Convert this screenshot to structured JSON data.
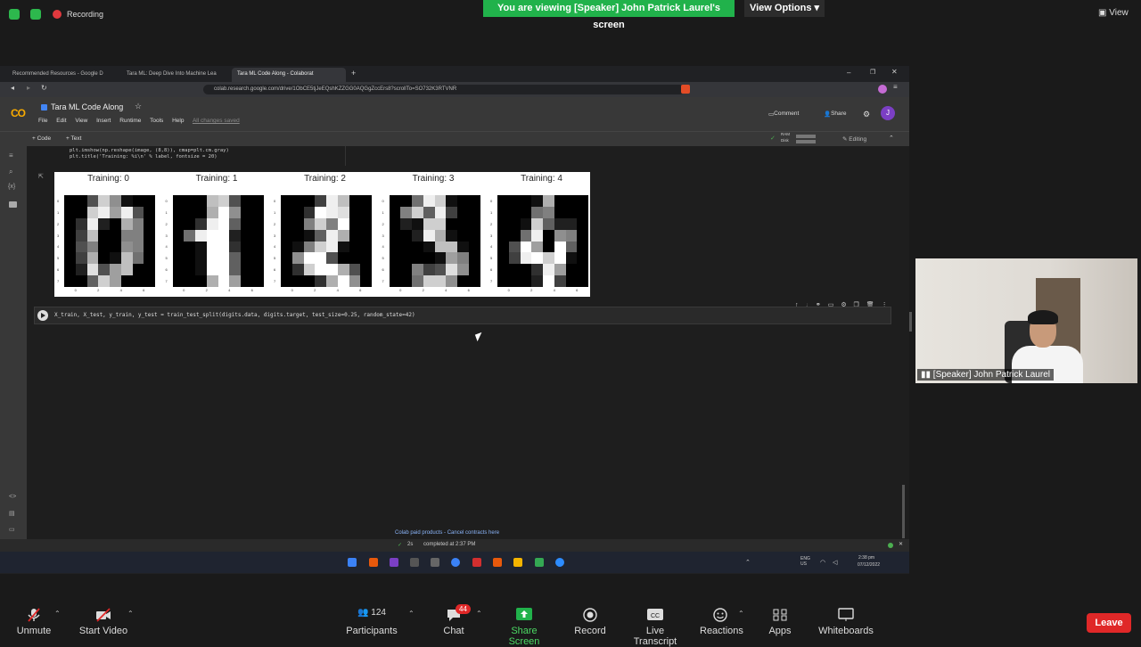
{
  "zoom_top": {
    "recording_label": "Recording",
    "banner": "You are viewing [Speaker] John Patrick Laurel's screen",
    "view_options": "View Options",
    "view": "View"
  },
  "browser": {
    "tabs": [
      "Recommended Resources - Google D",
      "Tara ML: Deep Dive Into Machine Lea",
      "Tara ML Code Along - Colaborat"
    ],
    "url": "colab.research.google.com/drive/1ObCE5tjJeEQshKZZGG0AQGgZccErs8?scrollTo=SO732K3RTVNR"
  },
  "colab": {
    "logo": "CO",
    "title": "Tara ML Code Along",
    "menu": [
      "File",
      "Edit",
      "View",
      "Insert",
      "Runtime",
      "Tools",
      "Help"
    ],
    "saved": "All changes saved",
    "comment": "Comment",
    "share": "Share",
    "avatar": "J",
    "add_code": "+ Code",
    "add_text": "+ Text",
    "ram": "RAM",
    "disk": "Disk",
    "editing": "Editing",
    "code_top_1": "plt.imshow(np.reshape(image, (8,8)), cmap=plt.cm.gray)",
    "code_top_2": "plt.title('Training: %i\\n' % label, fontsize = 20)",
    "code_cell": "X_train, X_test, y_train, y_test = train_test_split(digits.data, digits.target, test_size=0.25, random_state=42)",
    "footer_link": "Colab paid products - Cancel contracts here",
    "status_time": "2s",
    "status_text": "completed at 2:37 PM"
  },
  "digits": [
    {
      "title": "Training: 0",
      "pixels": [
        0,
        0,
        5,
        13,
        9,
        1,
        0,
        0,
        0,
        0,
        13,
        15,
        10,
        15,
        5,
        0,
        0,
        3,
        15,
        2,
        0,
        11,
        8,
        0,
        0,
        4,
        12,
        0,
        0,
        8,
        8,
        0,
        0,
        5,
        8,
        0,
        0,
        9,
        8,
        0,
        0,
        4,
        11,
        0,
        1,
        12,
        7,
        0,
        0,
        2,
        14,
        5,
        10,
        12,
        0,
        0,
        0,
        0,
        6,
        13,
        10,
        0,
        0,
        0
      ]
    },
    {
      "title": "Training: 1",
      "pixels": [
        0,
        0,
        0,
        12,
        13,
        5,
        0,
        0,
        0,
        0,
        0,
        11,
        16,
        9,
        0,
        0,
        0,
        0,
        3,
        15,
        16,
        6,
        0,
        0,
        0,
        7,
        15,
        16,
        16,
        2,
        0,
        0,
        0,
        0,
        1,
        16,
        16,
        3,
        0,
        0,
        0,
        0,
        1,
        16,
        16,
        6,
        0,
        0,
        0,
        0,
        1,
        16,
        16,
        6,
        0,
        0,
        0,
        0,
        0,
        11,
        16,
        10,
        0,
        0
      ]
    },
    {
      "title": "Training: 2",
      "pixels": [
        0,
        0,
        0,
        4,
        15,
        12,
        0,
        0,
        0,
        0,
        3,
        16,
        15,
        14,
        0,
        0,
        0,
        0,
        8,
        13,
        8,
        16,
        0,
        0,
        0,
        0,
        1,
        6,
        15,
        11,
        0,
        0,
        0,
        1,
        8,
        13,
        15,
        1,
        0,
        0,
        0,
        9,
        16,
        16,
        5,
        0,
        0,
        0,
        0,
        3,
        13,
        16,
        16,
        11,
        5,
        0,
        0,
        0,
        0,
        3,
        11,
        16,
        9,
        0
      ]
    },
    {
      "title": "Training: 3",
      "pixels": [
        0,
        0,
        7,
        15,
        13,
        1,
        0,
        0,
        0,
        8,
        13,
        6,
        15,
        4,
        0,
        0,
        0,
        2,
        1,
        13,
        13,
        0,
        0,
        0,
        0,
        0,
        2,
        15,
        11,
        1,
        0,
        0,
        0,
        0,
        0,
        1,
        12,
        12,
        1,
        0,
        0,
        0,
        0,
        0,
        1,
        10,
        8,
        0,
        0,
        0,
        8,
        4,
        5,
        14,
        9,
        0,
        0,
        0,
        7,
        13,
        13,
        9,
        0,
        0
      ]
    },
    {
      "title": "Training: 4",
      "pixels": [
        0,
        0,
        0,
        1,
        11,
        0,
        0,
        0,
        0,
        0,
        0,
        7,
        8,
        0,
        0,
        0,
        0,
        0,
        1,
        13,
        6,
        2,
        2,
        0,
        0,
        0,
        7,
        15,
        0,
        9,
        8,
        0,
        0,
        5,
        16,
        10,
        0,
        16,
        6,
        0,
        0,
        4,
        15,
        16,
        13,
        16,
        1,
        0,
        0,
        0,
        0,
        3,
        15,
        10,
        0,
        0,
        0,
        0,
        0,
        2,
        16,
        4,
        0,
        0
      ]
    }
  ],
  "taskbar": {
    "lang": "ENG\nUS",
    "time": "2:38 pm",
    "date": "07/12/2022"
  },
  "video": {
    "label": "[Speaker] John Patrick Laurel"
  },
  "zoom_bottom": {
    "unmute": "Unmute",
    "start_video": "Start Video",
    "participants": "Participants",
    "participants_count": "124",
    "chat": "Chat",
    "chat_badge": "44",
    "share_screen": "Share Screen",
    "record": "Record",
    "live_transcript": "Live Transcript",
    "reactions": "Reactions",
    "apps": "Apps",
    "whiteboards": "Whiteboards",
    "leave": "Leave"
  }
}
